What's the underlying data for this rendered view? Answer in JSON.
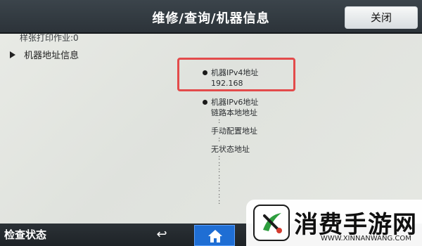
{
  "header": {
    "title": "维修/查询/机器信息",
    "close_label": "关闭"
  },
  "content": {
    "top_line": "样张打印作业:0",
    "section": "机器地址信息",
    "entries": [
      {
        "label": "机器IPv4地址",
        "value": "192.168"
      },
      {
        "label": "机器IPv6地址"
      },
      {
        "label": "链路本地地址"
      },
      {
        "label": "手动配置地址"
      },
      {
        "label": "无状态地址"
      }
    ],
    "dots": [
      ":",
      ":",
      ":",
      ":",
      ":",
      ":",
      ":",
      ":",
      ":",
      ":",
      ":",
      ":"
    ]
  },
  "footer": {
    "status_label": "检查状态",
    "back_symbol": "↩"
  },
  "watermark": {
    "text": "消费手游网",
    "url": "WWW.XINNANWANG.COM"
  },
  "colors": {
    "highlight": "#e34b4b",
    "home": "#1f6ed4"
  },
  "icons": {
    "back": "back-arrow-icon",
    "home": "home-icon",
    "section": "triangle-right-icon"
  }
}
